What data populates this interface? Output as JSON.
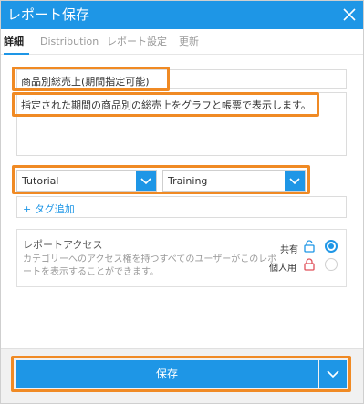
{
  "dialog": {
    "title": "レポート保存",
    "close_icon": "close-icon"
  },
  "tabs": [
    {
      "label": "詳細"
    },
    {
      "label": "Distribution"
    },
    {
      "label": "レポート設定"
    },
    {
      "label": "更新"
    }
  ],
  "form": {
    "report_name": "商品別総売上(期間指定可能)",
    "description": "指定された期間の商品別の総売上をグラフと帳票で表示します。",
    "folder": "Tutorial",
    "subfolder": "Training",
    "tag_add": "+ タグ追加"
  },
  "access": {
    "heading": "レポートアクセス",
    "description": "カテゴリーへのアクセス権を持つすべてのユーザーがこのレポートを表示することができます。",
    "shared_label": "共有",
    "private_label": "個人用",
    "selected": "shared"
  },
  "footer": {
    "save_label": "保存"
  },
  "colors": {
    "accent": "#1e96e6",
    "highlight": "#f08a24"
  }
}
